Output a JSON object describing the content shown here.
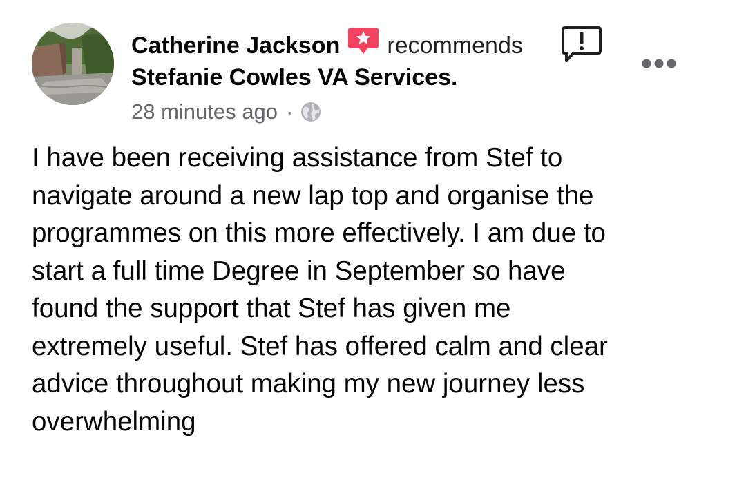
{
  "post": {
    "author_name": "Catherine Jackson",
    "recommend_icon": "recommend-star-badge-icon",
    "recommends_word": "recommends",
    "page_name": "Stefanie Cowles VA Services.",
    "timestamp": "28 minutes ago",
    "separator": "·",
    "audience_icon": "globe-icon",
    "report_icon": "report-exclamation-icon",
    "more_icon": "more-options-icon",
    "body": "I have been receiving assistance from Stef to\nnavigate around a new lap top and organise the\nprogrammes on this more effectively. I am due to\nstart a full time Degree in September so have\nfound the support that Stef has given me\nextremely useful. Stef has offered calm and clear\nadvice throughout making my new journey less\noverwhelming"
  },
  "colors": {
    "recommend_badge": "#f3425f",
    "meta_text": "#65676b",
    "body_text": "#050505"
  }
}
